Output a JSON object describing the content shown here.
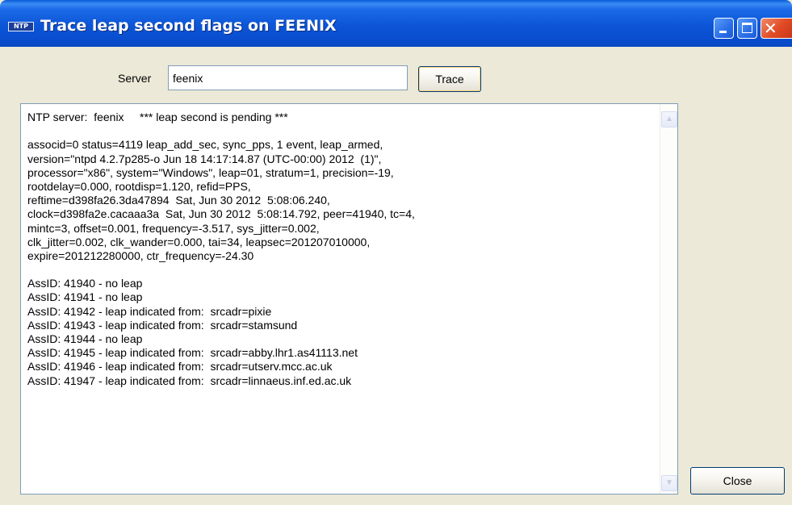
{
  "window": {
    "icon_text": "NTP",
    "title": "Trace leap second flags on FEENIX"
  },
  "server": {
    "label": "Server",
    "value": "feenix",
    "trace_label": "Trace"
  },
  "output": {
    "lines": [
      "NTP server:  feenix     *** leap second is pending ***",
      "",
      "associd=0 status=4119 leap_add_sec, sync_pps, 1 event, leap_armed,",
      "version=\"ntpd 4.2.7p285-o Jun 18 14:17:14.87 (UTC-00:00) 2012  (1)\",",
      "processor=\"x86\", system=\"Windows\", leap=01, stratum=1, precision=-19,",
      "rootdelay=0.000, rootdisp=1.120, refid=PPS,",
      "reftime=d398fa26.3da47894  Sat, Jun 30 2012  5:08:06.240,",
      "clock=d398fa2e.cacaaa3a  Sat, Jun 30 2012  5:08:14.792, peer=41940, tc=4,",
      "mintc=3, offset=0.001, frequency=-3.517, sys_jitter=0.002,",
      "clk_jitter=0.002, clk_wander=0.000, tai=34, leapsec=201207010000,",
      "expire=201212280000, ctr_frequency=-24.30",
      "",
      "AssID: 41940 - no leap",
      "AssID: 41941 - no leap",
      "AssID: 41942 - leap indicated from:  srcadr=pixie",
      "AssID: 41943 - leap indicated from:  srcadr=stamsund",
      "AssID: 41944 - no leap",
      "AssID: 41945 - leap indicated from:  srcadr=abby.lhr1.as41113.net",
      "AssID: 41946 - leap indicated from:  srcadr=utserv.mcc.ac.uk",
      "AssID: 41947 - leap indicated from:  srcadr=linnaeus.inf.ed.ac.uk"
    ]
  },
  "buttons": {
    "close_label": "Close"
  },
  "icons": {
    "minimize": "minimize-icon",
    "maximize": "maximize-icon",
    "close": "close-icon",
    "scroll_up": "chevron-up-icon",
    "scroll_down": "chevron-down-icon"
  },
  "colors": {
    "titlebar": "#0a55d6",
    "window_face": "#ece9d8",
    "close_button": "#e04a24"
  }
}
